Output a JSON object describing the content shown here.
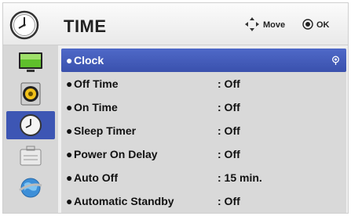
{
  "header": {
    "title": "TIME",
    "move_label": "Move",
    "ok_label": "OK"
  },
  "sidebar": {
    "items": [
      {
        "icon": "picture-icon"
      },
      {
        "icon": "audio-icon"
      },
      {
        "icon": "time-icon",
        "active": true
      },
      {
        "icon": "option-icon"
      },
      {
        "icon": "network-icon"
      }
    ]
  },
  "menu": {
    "bullet": "●",
    "items": [
      {
        "label": "Clock",
        "value": "",
        "selected": true
      },
      {
        "label": "Off Time",
        "value": ": Off"
      },
      {
        "label": "On Time",
        "value": ": Off"
      },
      {
        "label": "Sleep Timer",
        "value": ": Off"
      },
      {
        "label": "Power On Delay",
        "value": ": Off"
      },
      {
        "label": "Auto Off",
        "value": ": 15 min."
      },
      {
        "label": "Automatic Standby",
        "value": ": Off"
      }
    ]
  },
  "colors": {
    "selection": "#3d56b4",
    "panel": "#d9d9d9",
    "header": "#efefef"
  }
}
